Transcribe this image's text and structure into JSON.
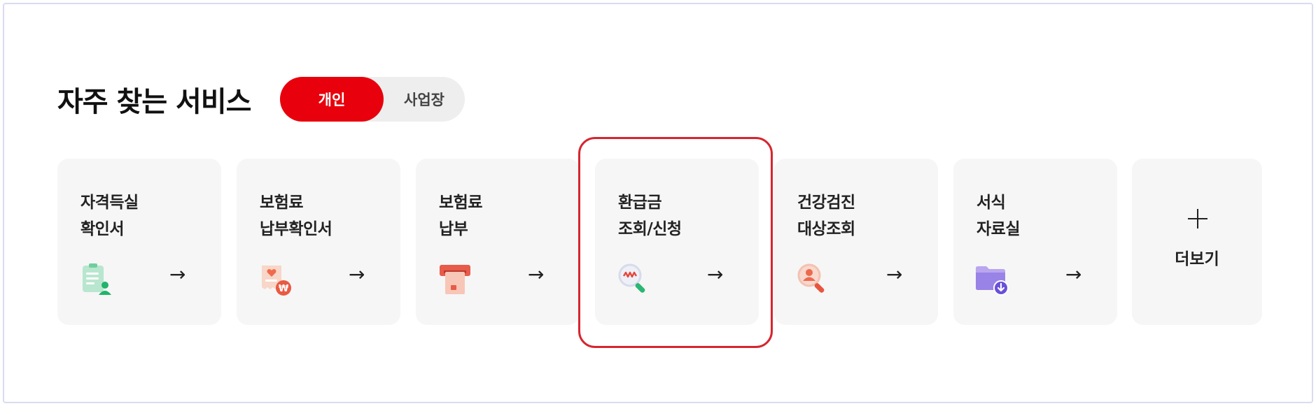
{
  "section": {
    "title": "자주 찾는 서비스",
    "toggle": {
      "options": [
        "개인",
        "사업장"
      ],
      "selected": "개인"
    }
  },
  "cards": [
    {
      "line1": "자격득실",
      "line2": "확인서",
      "icon": "certificate-user-icon",
      "arrow": "→"
    },
    {
      "line1": "보험료",
      "line2": "납부확인서",
      "icon": "receipt-won-icon",
      "arrow": "→"
    },
    {
      "line1": "보험료",
      "line2": "납부",
      "icon": "card-payment-icon",
      "arrow": "→"
    },
    {
      "line1": "환급금",
      "line2": "조회/신청",
      "icon": "refund-search-icon",
      "arrow": "→"
    },
    {
      "line1": "건강검진",
      "line2": "대상조회",
      "icon": "checkup-search-icon",
      "arrow": "→"
    },
    {
      "line1": "서식",
      "line2": "자료실",
      "icon": "folder-download-icon",
      "arrow": "→"
    }
  ],
  "more": {
    "label": "더보기",
    "icon": "plus-icon"
  },
  "colors": {
    "accent": "#e8000c",
    "highlight": "#d6262f",
    "card_bg": "#f6f6f6"
  }
}
